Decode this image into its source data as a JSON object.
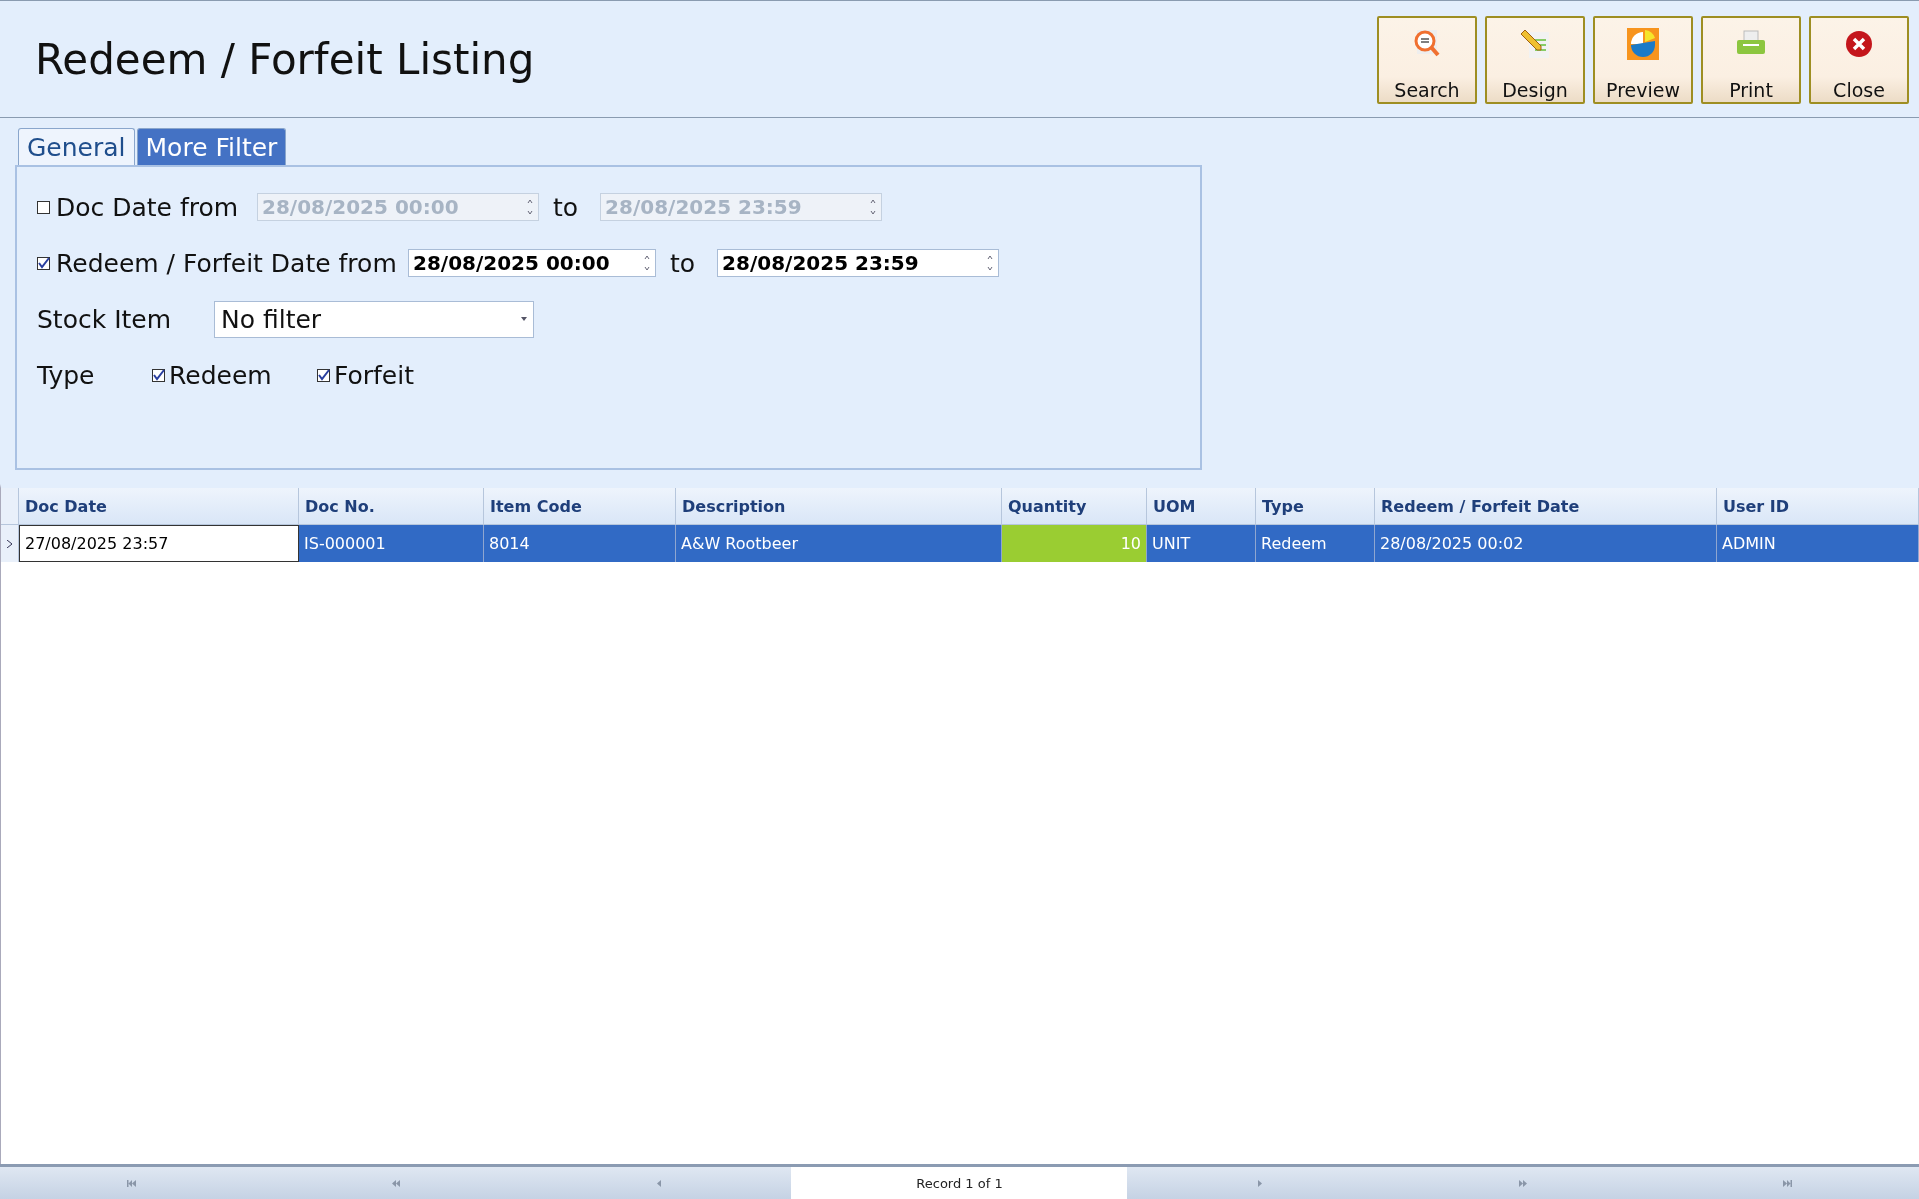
{
  "window": {
    "title": "Redeem / Forfeit Listing"
  },
  "toolbar": [
    "Search",
    "Design",
    "Preview",
    "Print",
    "Close"
  ],
  "tabs": [
    {
      "label": "General",
      "selected": true
    },
    {
      "label": "More Filter",
      "selected": false
    }
  ],
  "filters": {
    "doc_date": {
      "label": "Doc Date from",
      "checked": false,
      "from": "28/08/2025 00:00",
      "to_label": "to",
      "to": "28/08/2025 23:59",
      "disabled": true
    },
    "redeem_date": {
      "label": "Redeem / Forfeit Date from",
      "checked": true,
      "from": "28/08/2025 00:00",
      "to_label": "to",
      "to": "28/08/2025 23:59",
      "disabled": false
    },
    "stock_item": {
      "label": "Stock Item",
      "value": "No filter"
    },
    "type": {
      "label": "Type",
      "options": [
        {
          "label": "Redeem",
          "checked": true
        },
        {
          "label": "Forfeit",
          "checked": true
        }
      ]
    }
  },
  "table": {
    "columns": [
      "Doc Date",
      "Doc No.",
      "Item Code",
      "Description",
      "Quantity",
      "UOM",
      "Type",
      "Redeem / Forfeit Date",
      "User ID"
    ],
    "rows": [
      {
        "selected": true,
        "cells": [
          {
            "text": "27/08/2025 23:57",
            "focused": true,
            "highlighted": false
          },
          {
            "text": "IS-000001",
            "focused": false,
            "highlighted": false
          },
          {
            "text": "8014",
            "focused": false,
            "highlighted": false
          },
          {
            "text": "A&W Rootbeer",
            "focused": false,
            "highlighted": false
          },
          {
            "text": "10",
            "focused": false,
            "highlighted": true
          },
          {
            "text": "UNIT",
            "focused": false,
            "highlighted": false
          },
          {
            "text": "Redeem",
            "focused": false,
            "highlighted": false
          },
          {
            "text": "28/08/2025 00:02",
            "focused": false,
            "highlighted": false
          },
          {
            "text": "ADMIN",
            "focused": false,
            "highlighted": false
          }
        ]
      }
    ]
  },
  "navigator": {
    "record": "Record 1 of 1"
  }
}
